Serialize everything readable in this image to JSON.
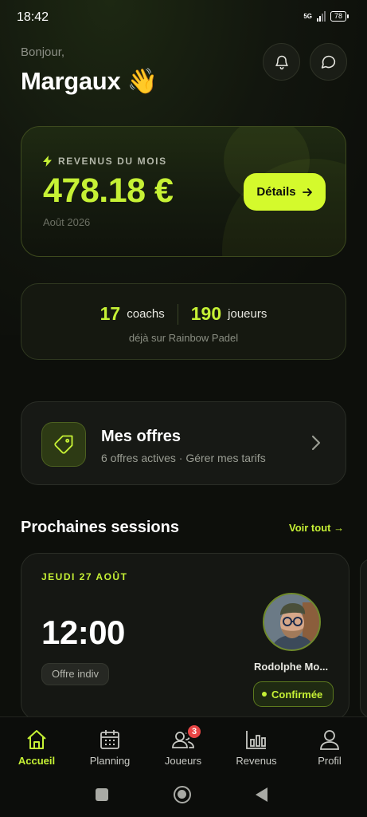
{
  "status_bar": {
    "time": "18:42",
    "network": "5G",
    "battery": "78"
  },
  "header": {
    "greeting": "Bonjour,",
    "name": "Margaux 👋"
  },
  "revenue": {
    "label": "REVENUS DU MOIS",
    "amount": "478.18 €",
    "period": "Août 2026",
    "details_label": "Détails"
  },
  "stats": {
    "coaches_count": "17",
    "coaches_label": "coachs",
    "players_count": "190",
    "players_label": "joueurs",
    "subtitle": "déjà sur Rainbow Padel"
  },
  "offers": {
    "title": "Mes offres",
    "subtitle": "6 offres actives · Gérer mes tarifs"
  },
  "sessions": {
    "title": "Prochaines sessions",
    "see_all": "Voir tout →",
    "items": [
      {
        "date": "JEUDI 27 AOÛT",
        "time": "12:00",
        "offer": "Offre indiv",
        "player": "Rodolphe Mo...",
        "status": "Confirmée"
      }
    ]
  },
  "nav": {
    "items": [
      {
        "label": "Accueil",
        "icon": "home-icon",
        "active": true
      },
      {
        "label": "Planning",
        "icon": "calendar-icon"
      },
      {
        "label": "Joueurs",
        "icon": "users-icon",
        "badge": "3"
      },
      {
        "label": "Revenus",
        "icon": "bar-chart-icon"
      },
      {
        "label": "Profil",
        "icon": "user-icon"
      }
    ]
  },
  "colors": {
    "accent": "#c6f135",
    "button": "#d4fa2c",
    "background": "#0d0f0b",
    "badge": "#e84545"
  }
}
